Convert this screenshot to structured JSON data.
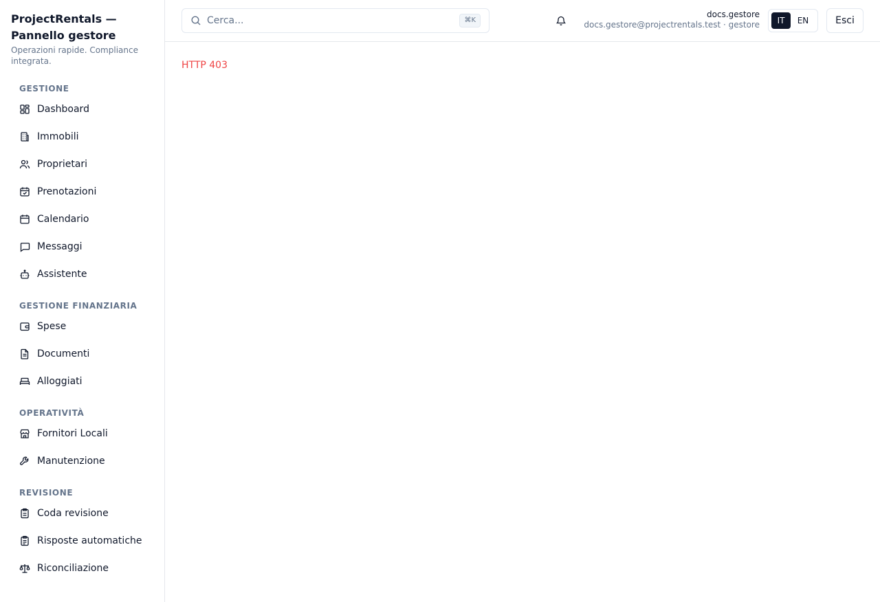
{
  "brand": {
    "title": "ProjectRentals — Pannello gestore",
    "subtitle": "Operazioni rapide. Compliance integrata."
  },
  "sidebar": {
    "sections": [
      {
        "title": "GESTIONE",
        "items": [
          {
            "label": "Dashboard",
            "icon": "dashboard-icon"
          },
          {
            "label": "Immobili",
            "icon": "building-icon"
          },
          {
            "label": "Proprietari",
            "icon": "users-icon"
          },
          {
            "label": "Prenotazioni",
            "icon": "calendar-check-icon"
          },
          {
            "label": "Calendario",
            "icon": "calendar-icon"
          },
          {
            "label": "Messaggi",
            "icon": "message-icon"
          },
          {
            "label": "Assistente",
            "icon": "bot-icon"
          }
        ]
      },
      {
        "title": "GESTIONE FINANZIARIA",
        "items": [
          {
            "label": "Spese",
            "icon": "wallet-icon"
          },
          {
            "label": "Documenti",
            "icon": "file-icon"
          },
          {
            "label": "Alloggiati",
            "icon": "bed-icon"
          }
        ]
      },
      {
        "title": "OPERATIVITÀ",
        "items": [
          {
            "label": "Fornitori Locali",
            "icon": "store-icon"
          },
          {
            "label": "Manutenzione",
            "icon": "wrench-icon"
          }
        ]
      },
      {
        "title": "REVISIONE",
        "items": [
          {
            "label": "Coda revisione",
            "icon": "clipboard-icon"
          },
          {
            "label": "Risposte automatiche",
            "icon": "clipboard-list-icon"
          },
          {
            "label": "Riconciliazione",
            "icon": "scale-icon"
          }
        ]
      }
    ]
  },
  "topbar": {
    "search_placeholder": "Cerca...",
    "search_shortcut": "⌘K",
    "user_name": "docs.gestore",
    "user_meta": "docs.gestore@projectrentals.test · gestore",
    "lang_it": "IT",
    "lang_en": "EN",
    "active_lang": "IT",
    "logout_label": "Esci"
  },
  "main": {
    "error_text": "HTTP 403"
  },
  "colors": {
    "accent_dark": "#0f172a",
    "error": "#ef4444",
    "muted": "#64748b",
    "border": "#e5e7eb"
  }
}
